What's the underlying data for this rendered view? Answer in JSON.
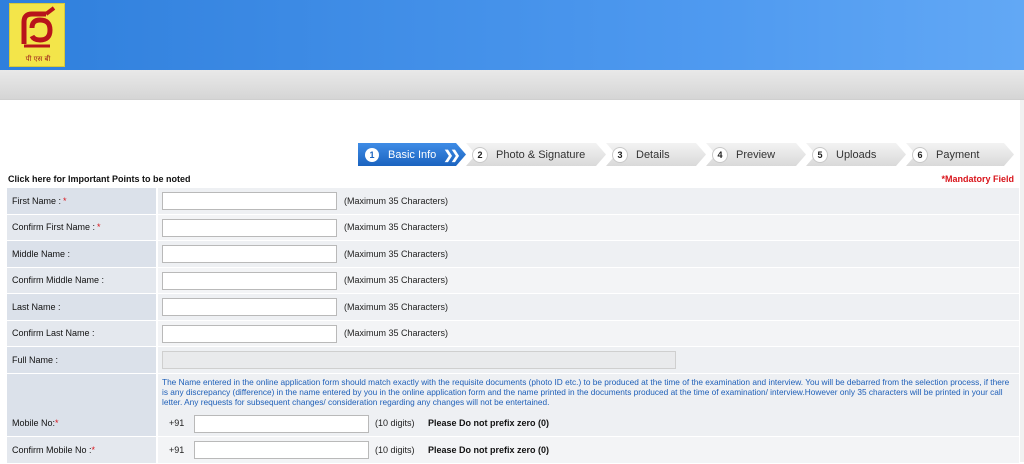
{
  "header": {
    "logo_text": "पी एस बी",
    "brand_color": "#2f7fdc",
    "logo_color": "#f3e54a"
  },
  "steps": [
    {
      "num": "1",
      "label": "Basic Info",
      "active": true
    },
    {
      "num": "2",
      "label": "Photo & Signature",
      "active": false
    },
    {
      "num": "3",
      "label": "Details",
      "active": false
    },
    {
      "num": "4",
      "label": "Preview",
      "active": false
    },
    {
      "num": "5",
      "label": "Uploads",
      "active": false
    },
    {
      "num": "6",
      "label": "Payment",
      "active": false
    }
  ],
  "important_link": "Click here for Important Points to be noted",
  "mandatory_note": "*Mandatory Field",
  "fields": [
    {
      "label": "First Name :",
      "required": "*",
      "value": "",
      "hint": "(Maximum 35 Characters)"
    },
    {
      "label": "Confirm First Name :",
      "required": "*",
      "value": "",
      "hint": "(Maximum 35 Characters)"
    },
    {
      "label": "Middle Name :",
      "required": "",
      "value": "",
      "hint": "(Maximum 35 Characters)"
    },
    {
      "label": "Confirm Middle Name :",
      "required": "",
      "value": "",
      "hint": "(Maximum 35 Characters)"
    },
    {
      "label": "Last Name :",
      "required": "",
      "value": "",
      "hint": "(Maximum 35 Characters)"
    },
    {
      "label": "Confirm Last Name :",
      "required": "",
      "value": "",
      "hint": "(Maximum 35 Characters)"
    }
  ],
  "full_name": {
    "label": "Full Name :",
    "value": ""
  },
  "name_note": "The Name entered in the online application form should match exactly with the requisite documents (photo ID etc.) to be produced at the time of the examination and interview. You will be debarred from the selection process, if there is any discrepancy (difference) in the name entered by you in the online application form and the name printed in the documents produced at the time of examination/ interview.However only 35 characters will be printed in your call letter. Any requests for subsequent changes/ consideration regarding any changes will not be entertained.",
  "mobile": {
    "label": "Mobile No:",
    "confirm_label": "Confirm Mobile No :",
    "required": "*",
    "prefix": "+91",
    "value": "",
    "confirm_value": "",
    "hint": "(10 digits)",
    "warning": "Please Do not prefix zero (0)"
  }
}
